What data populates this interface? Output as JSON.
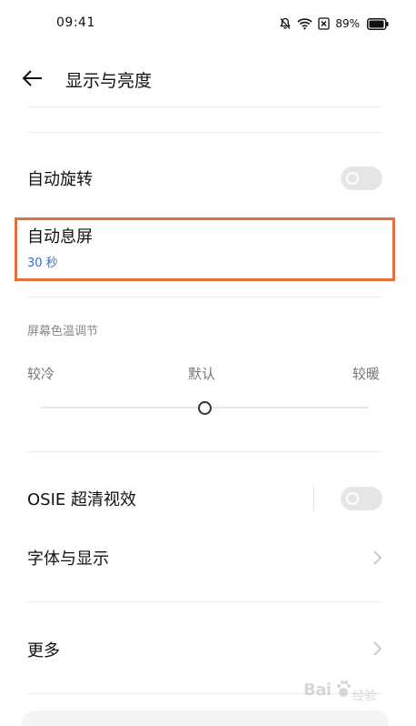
{
  "status_bar": {
    "time": "09:41",
    "battery": "89%",
    "icons": [
      "mute-bell-icon",
      "wifi-icon",
      "sim-off-icon",
      "battery-icon"
    ]
  },
  "header": {
    "back_icon": "arrow-left-icon",
    "title": "显示与亮度"
  },
  "settings": {
    "auto_rotate": {
      "label": "自动旋转",
      "enabled": false
    },
    "auto_screen_off": {
      "label": "自动息屏",
      "value": "30 秒"
    },
    "color_temperature": {
      "section_title": "屏幕色温调节",
      "left_label": "较冷",
      "center_label": "默认",
      "right_label": "较暖",
      "level": 0.5
    },
    "osie": {
      "label": "OSIE 超清视效",
      "enabled": false
    },
    "font_display": {
      "label": "字体与显示"
    },
    "more": {
      "label": "更多"
    }
  },
  "watermark": {
    "brand": "Bai",
    "sub": "经验"
  },
  "colors": {
    "accent_blue": "#2f6fd6",
    "highlight": "#e0703c",
    "toggle_off": "#e6e6e6"
  }
}
